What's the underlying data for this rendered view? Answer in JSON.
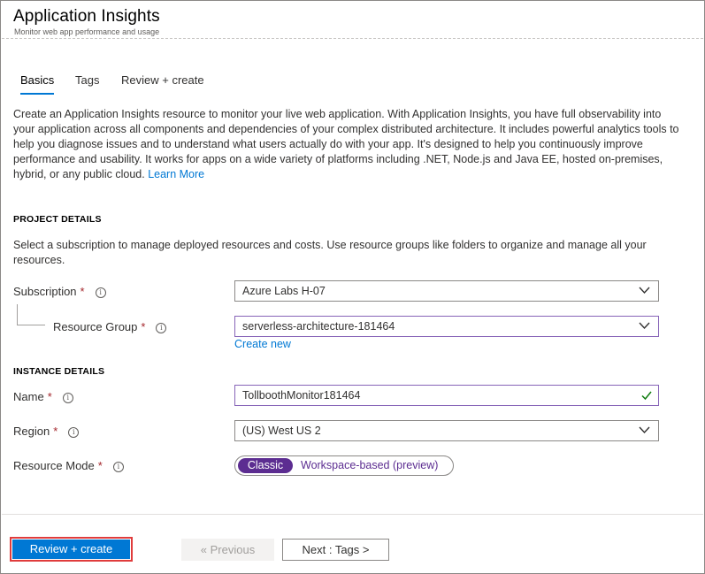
{
  "header": {
    "title": "Application Insights",
    "subtitle": "Monitor web app performance and usage"
  },
  "tabs": [
    {
      "label": "Basics",
      "active": true
    },
    {
      "label": "Tags",
      "active": false
    },
    {
      "label": "Review + create",
      "active": false
    }
  ],
  "description": {
    "text": "Create an Application Insights resource to monitor your live web application. With Application Insights, you have full observability into your application across all components and dependencies of your complex distributed architecture. It includes powerful analytics tools to help you diagnose issues and to understand what users actually do with your app. It's designed to help you continuously improve performance and usability. It works for apps on a wide variety of platforms including .NET, Node.js and Java EE, hosted on-premises, hybrid, or any public cloud.",
    "link": "Learn More"
  },
  "project_details": {
    "title": "PROJECT DETAILS",
    "description": "Select a subscription to manage deployed resources and costs. Use resource groups like folders to organize and manage all your resources.",
    "subscription": {
      "label": "Subscription",
      "required": "*",
      "value": "Azure Labs H-07"
    },
    "resource_group": {
      "label": "Resource Group",
      "required": "*",
      "value": "serverless-architecture-181464",
      "create_new": "Create new"
    }
  },
  "instance_details": {
    "title": "INSTANCE DETAILS",
    "name": {
      "label": "Name",
      "required": "*",
      "value": "TollboothMonitor181464"
    },
    "region": {
      "label": "Region",
      "required": "*",
      "value": "(US) West US 2"
    },
    "resource_mode": {
      "label": "Resource Mode",
      "required": "*",
      "options": [
        "Classic",
        "Workspace-based (preview)"
      ],
      "selected": "Classic"
    }
  },
  "footer": {
    "review_create": "Review + create",
    "previous": "« Previous",
    "next": "Next : Tags >"
  },
  "colors": {
    "accent": "#0078d4",
    "toggle_selected": "#5c2d91",
    "required": "#a4262c",
    "highlight_border": "#e03c3c",
    "valid_check": "#107c10"
  },
  "icons": {
    "info": "info-icon",
    "dropdown": "chevron-down-icon",
    "valid": "checkmark-icon"
  }
}
